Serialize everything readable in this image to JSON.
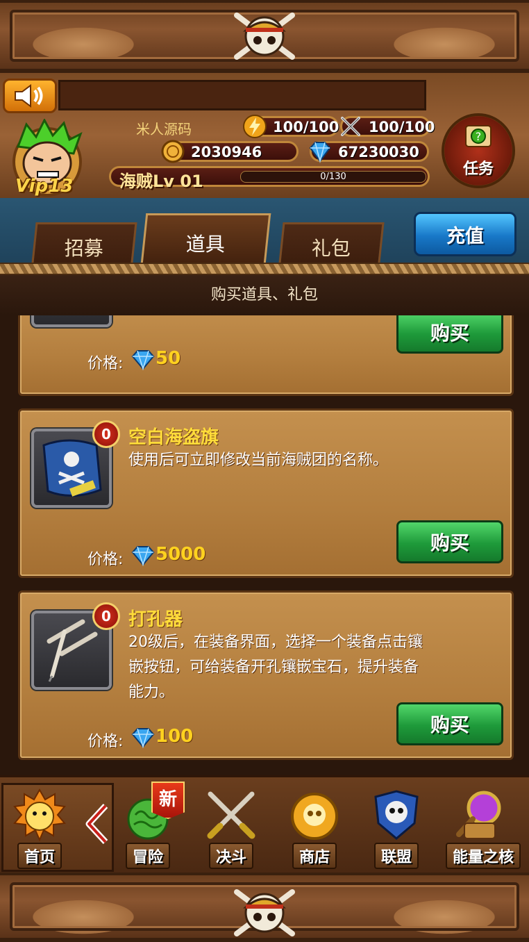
{
  "header": {
    "player_name": "米人源码",
    "vip": "Vip13",
    "energy": "100/100",
    "stamina": "100/100",
    "gold": "2030946",
    "diamonds": "67230030",
    "level": "海贼Lv 01",
    "exp": "0/130",
    "task_label": "任务"
  },
  "tabs": [
    {
      "label": "招募"
    },
    {
      "label": "道具"
    },
    {
      "label": "礼包"
    }
  ],
  "active_tab": "道具",
  "recharge_label": "充值",
  "subheader": "购买道具、礼包",
  "items": [
    {
      "price_label": "价格:",
      "price": "50",
      "buy_label": "购买"
    },
    {
      "badge": "0",
      "title": "空白海盗旗",
      "desc": "使用后可立即修改当前海贼团的名称。",
      "price_label": "价格:",
      "price": "5000",
      "buy_label": "购买"
    },
    {
      "badge": "0",
      "title": "打孔器",
      "desc_lines": [
        "20级后，在装备界面，选择一个装备点击镶",
        "嵌按钮，可给装备开孔镶嵌宝石，提升装备",
        "能力。"
      ],
      "price_label": "价格:",
      "price": "100",
      "buy_label": "购买"
    }
  ],
  "nav": {
    "home": "首页",
    "adventure": "冒险",
    "new_tag": "新",
    "duel": "决斗",
    "shop": "商店",
    "alliance": "联盟",
    "energy_core": "能量之核"
  },
  "colors": {
    "gold_text": "#ffdc3a",
    "buy_green": "#1e9a3a",
    "recharge_blue": "#1878c8",
    "wood": "#b37e3e"
  }
}
